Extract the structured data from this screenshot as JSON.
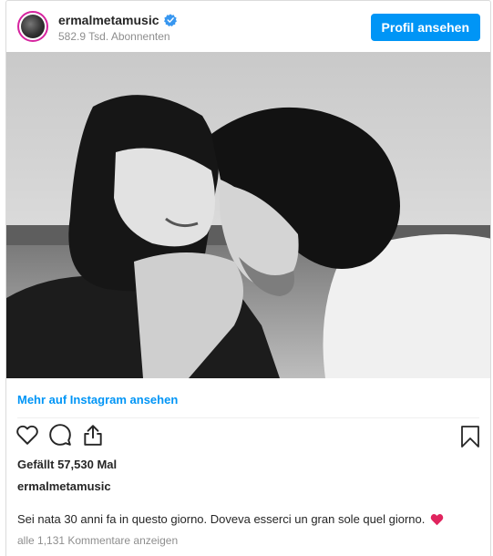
{
  "header": {
    "username": "ermalmetamusic",
    "followers": "582.9 Tsd. Abonnenten",
    "profile_button": "Profil ansehen",
    "verified_icon": "verified-badge-icon",
    "accent_color": "#0095f6"
  },
  "post": {
    "photo_icon": "photo-black-white-couple",
    "more_link": "Mehr auf Instagram ansehen",
    "actions": [
      "heart-icon",
      "comment-icon",
      "share-icon",
      "bookmark-icon"
    ],
    "likes": "Gefällt 57,530 Mal",
    "author": "ermalmetamusic",
    "caption": "Sei nata 30 anni fa in questo giorno. Doveva esserci un gran sole quel giorno.",
    "caption_emoji": "red-heart-icon",
    "comments": "alle 1,131 Kommentare anzeigen"
  }
}
